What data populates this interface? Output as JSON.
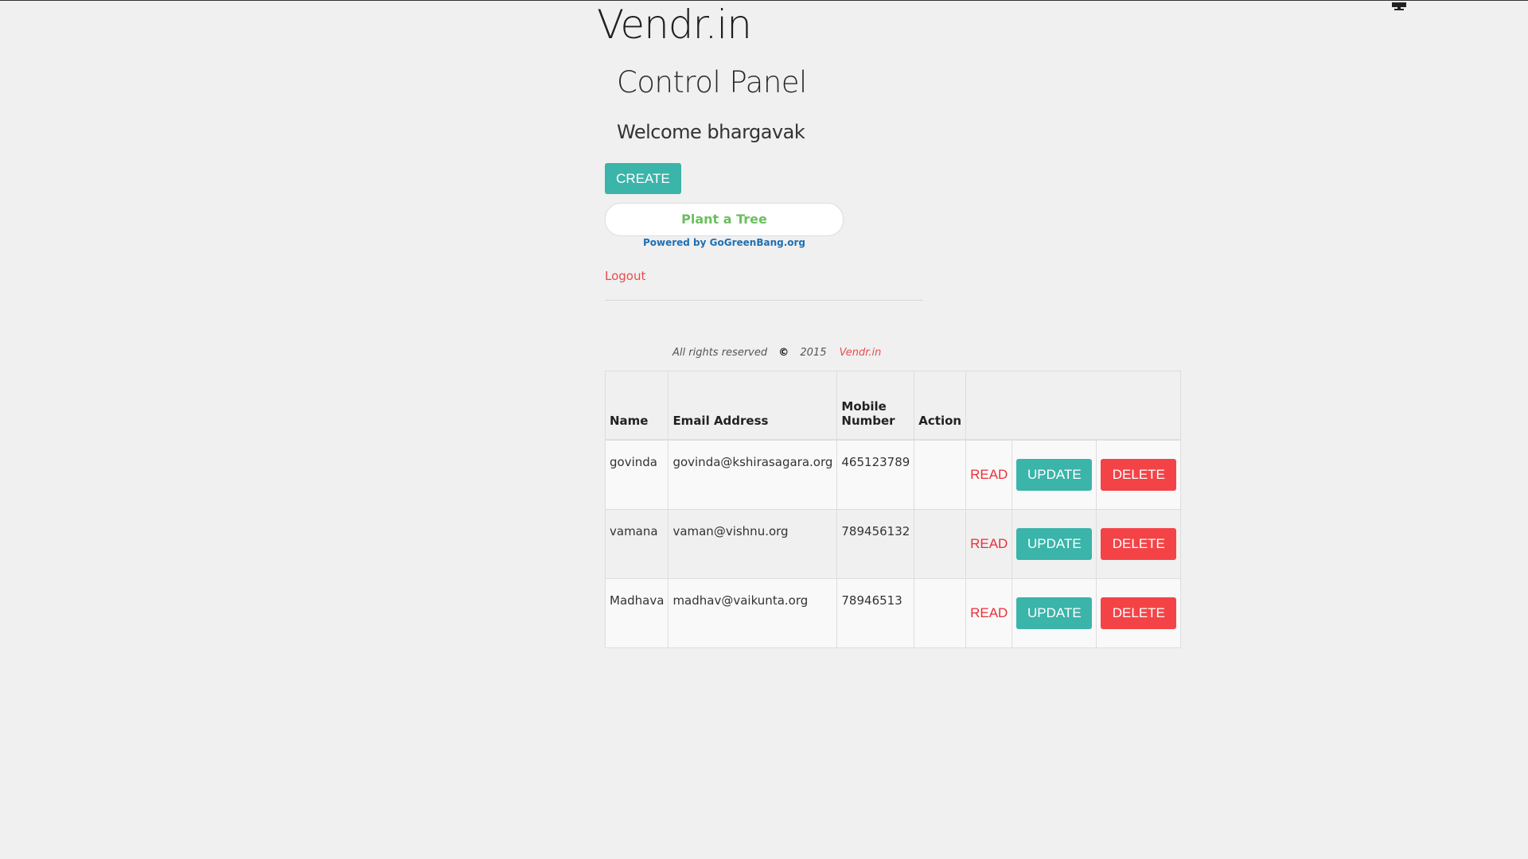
{
  "header": {
    "brand": "Vendr.in",
    "panel_title": "Control Panel",
    "welcome": "Welcome bhargavak"
  },
  "actions": {
    "create_label": "CREATE",
    "plant_label": "Plant a Tree",
    "powered_by": "Powered by GoGreenBang.org",
    "logout_label": "Logout"
  },
  "footer": {
    "rights": "All rights reserved",
    "copyright_symbol": "©",
    "year": "2015",
    "brand_link": "Vendr.in"
  },
  "table": {
    "headers": {
      "name": "Name",
      "email": "Email Address",
      "mobile": "Mobile Number",
      "action": "Action"
    },
    "row_actions": {
      "read": "READ",
      "update": "UPDATE",
      "delete": "DELETE"
    },
    "rows": [
      {
        "name": "govinda",
        "email": "govinda@kshirasagara.org",
        "mobile": "465123789"
      },
      {
        "name": "vamana",
        "email": "vaman@vishnu.org",
        "mobile": "789456132"
      },
      {
        "name": "Madhava",
        "email": "madhav@vaikunta.org",
        "mobile": "78946513"
      }
    ]
  },
  "colors": {
    "teal": "#3bb4aa",
    "red": "#f44347",
    "link_red": "#e84c4c",
    "background": "#f0f0f0"
  },
  "icons": {
    "top_right": "monitor-icon"
  }
}
